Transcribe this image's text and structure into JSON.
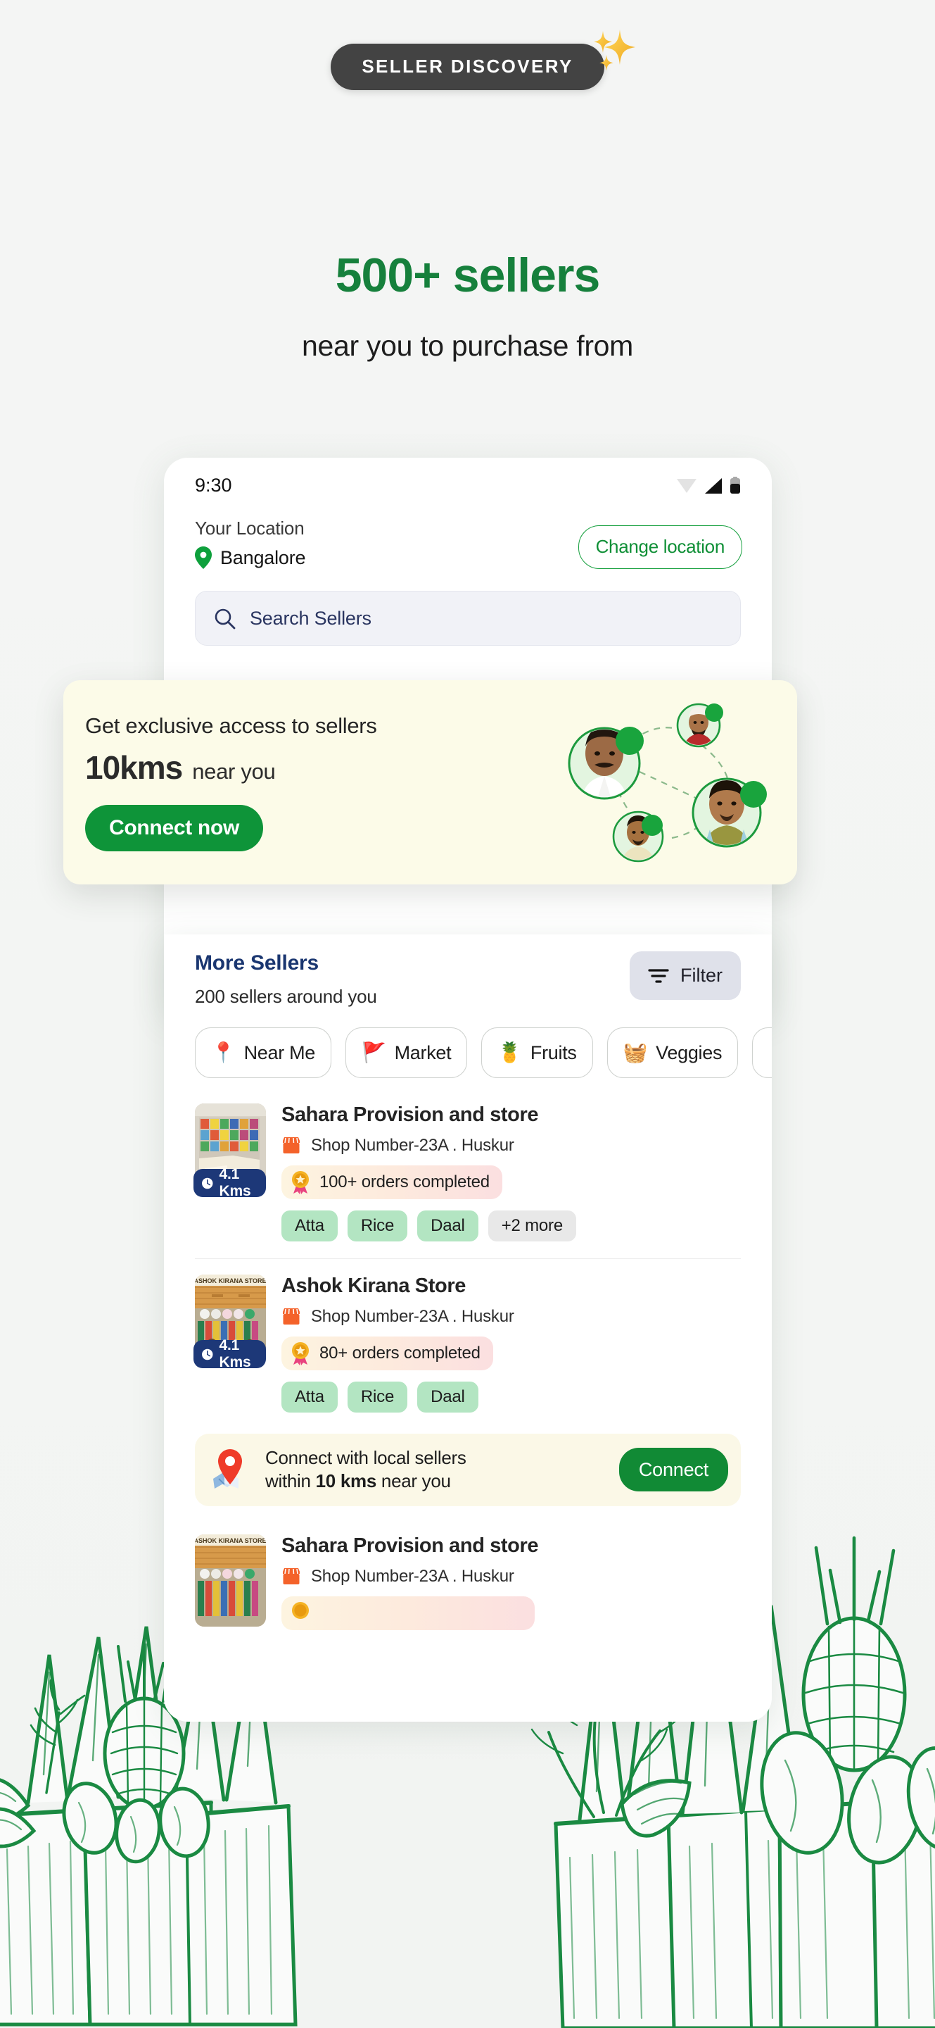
{
  "hero": {
    "badge_label": "SELLER DISCOVERY",
    "badge_icon": "sparkles-icon",
    "headline": "500+ sellers",
    "subheadline": "near you to purchase from"
  },
  "colors": {
    "brand_green": "#16803c",
    "button_green": "#0e9439",
    "badge_dark": "#434343",
    "navy": "#1a3670",
    "distance_navy": "#1d3878",
    "cream": "#fcfbe8",
    "tag_green": "#b3e5c2",
    "page_bg": "#f4f5f4"
  },
  "phone": {
    "status_bar": {
      "time": "9:30",
      "icons": [
        "wifi-icon",
        "signal-icon",
        "battery-icon"
      ]
    },
    "location": {
      "label": "Your Location",
      "city": "Bangalore",
      "pin_icon": "location-pin-icon",
      "change_button": "Change location"
    },
    "search": {
      "icon": "search-icon",
      "placeholder": "Search Sellers",
      "value": ""
    },
    "more_sellers": {
      "title": "More Sellers",
      "subtitle": "200 sellers around you",
      "filter_label": "Filter",
      "filter_icon": "filter-icon"
    },
    "chips": [
      {
        "label": "Near Me",
        "emoji": "📍",
        "icon": "location-pin-icon"
      },
      {
        "label": "Market",
        "emoji": "🚩",
        "icon": "flag-icon"
      },
      {
        "label": "Fruits",
        "emoji": "🍍",
        "icon": "fruits-icon"
      },
      {
        "label": "Veggies",
        "emoji": "🧺",
        "icon": "veggies-basket-icon"
      },
      {
        "label": "",
        "emoji": "",
        "icon": "chip-cut-off"
      }
    ],
    "sellers": [
      {
        "name": "Sahara Provision and store",
        "shop_icon": "storefront-icon",
        "address": "Shop Number-23A  .  Huskur",
        "orders_badge": "100+ orders completed",
        "orders_icon": "medal-icon",
        "distance": "4.1 Kms",
        "distance_icon": "clock-icon",
        "tags": [
          "Atta",
          "Rice",
          "Daal"
        ],
        "more_tag": "+2 more"
      },
      {
        "name": "Ashok Kirana Store",
        "shop_icon": "storefront-icon",
        "address": "Shop Number-23A  .  Huskur",
        "orders_badge": "80+ orders completed",
        "orders_icon": "medal-icon",
        "distance": "4.1 Kms",
        "distance_icon": "clock-icon",
        "tags": [
          "Atta",
          "Rice",
          "Daal"
        ],
        "more_tag": ""
      },
      {
        "name": "Sahara Provision and store",
        "shop_icon": "storefront-icon",
        "address": "Shop Number-23A  .  Huskur",
        "orders_badge": "",
        "orders_icon": "medal-icon",
        "distance": "",
        "distance_icon": "clock-icon",
        "tags": [],
        "more_tag": ""
      }
    ],
    "connect_banner": {
      "map_icon": "map-pin-icon",
      "text_line1": "Connect with local sellers",
      "text_line2_pre": "within ",
      "text_line2_bold": "10 kms",
      "text_line2_post": " near you",
      "button_label": "Connect"
    }
  },
  "overlay_card": {
    "line1": "Get exclusive access to sellers",
    "distance": "10kms",
    "near_you": "near you",
    "button_label": "Connect now",
    "graphic": "seller-network-graphic"
  },
  "decoration": {
    "bottom_art": "grocery-bags-line-art"
  }
}
